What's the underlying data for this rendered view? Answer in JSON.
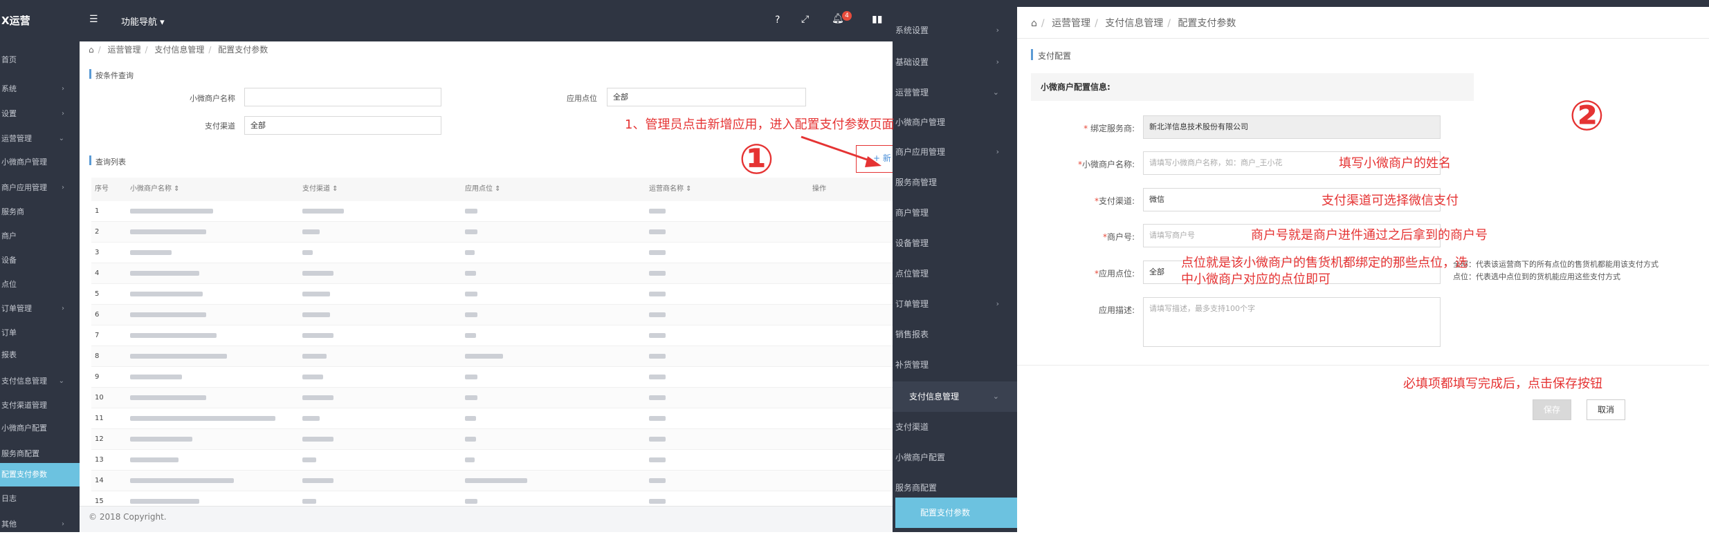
{
  "left": {
    "logo": "X运营",
    "nav_label": "功能导航",
    "sidebar": [
      {
        "label": "首页",
        "chev": ""
      },
      {
        "label": "系统",
        "chev": "›"
      },
      {
        "label": "设置",
        "chev": "›"
      },
      {
        "label": "运营管理",
        "chev": "⌄"
      },
      {
        "label": "小微商户管理",
        "chev": ""
      },
      {
        "label": "商户应用管理",
        "chev": "›"
      },
      {
        "label": "服务商",
        "chev": ""
      },
      {
        "label": "商户",
        "chev": ""
      },
      {
        "label": "设备",
        "chev": ""
      },
      {
        "label": "点位",
        "chev": ""
      },
      {
        "label": "订单管理",
        "chev": "›"
      },
      {
        "label": "订单",
        "chev": ""
      },
      {
        "label": "报表",
        "chev": ""
      },
      {
        "label": "支付信息管理",
        "chev": "⌄"
      },
      {
        "label": "支付渠道管理",
        "chev": ""
      },
      {
        "label": "小微商户配置",
        "chev": ""
      },
      {
        "label": "服务商配置",
        "chev": ""
      },
      {
        "label": "配置支付参数",
        "chev": ""
      },
      {
        "label": "日志",
        "chev": ""
      },
      {
        "label": "其他",
        "chev": "›"
      }
    ],
    "breadcrumb": [
      "运营管理",
      "支付信息管理",
      "配置支付参数"
    ],
    "search_section": "按条件查询",
    "filter": {
      "merchant_label": "小微商户名称",
      "merchant_value": "",
      "point_label": "应用点位",
      "point_value": "全部",
      "channel_label": "支付渠道",
      "channel_value": "全部"
    },
    "list_section": "查询列表",
    "add_label": "+ 新",
    "columns": [
      "序号",
      "小微商户名称 ⇕",
      "支付渠道 ⇕",
      "应用点位 ⇕",
      "运营商名称 ⇕",
      "操作"
    ],
    "rows": [
      "1",
      "2",
      "3",
      "4",
      "5",
      "6",
      "7",
      "8",
      "9",
      "10",
      "11",
      "12",
      "13",
      "14",
      "15"
    ],
    "footer": "© 2018 Copyright."
  },
  "right": {
    "breadcrumb": [
      "运营管理",
      "支付信息管理",
      "配置支付参数"
    ],
    "section_title": "支付配置",
    "sub_header": "小微商户配置信息:",
    "fields": {
      "provider_label": "绑定服务商:",
      "provider_value": "新北洋信息技术股份有限公司",
      "merchant_label": "小微商户名称:",
      "merchant_placeholder": "请填写小微商户名称，如：商户_王小花",
      "channel_label": "支付渠道:",
      "channel_value": "微信",
      "merchant_no_label": "商户号:",
      "merchant_no_placeholder": "请填写商户号",
      "point_label": "应用点位:",
      "point_value": "全部",
      "desc_label": "应用描述:",
      "desc_placeholder": "请填写描述，最多支持100个字"
    },
    "hints": {
      "all": "全部：代表该运营商下的所有点位的售货机都能用该支付方式",
      "point": "点位：代表选中点位到的货机能应用这些支付方式"
    },
    "save_label": "保存",
    "cancel_label": "取消",
    "sidebar": [
      {
        "label": "系统设置",
        "chev": "›"
      },
      {
        "label": "基础设置",
        "chev": "›"
      },
      {
        "label": "运营管理",
        "chev": "⌄"
      },
      {
        "label": "小微商户管理",
        "chev": ""
      },
      {
        "label": "商户应用管理",
        "chev": "›"
      },
      {
        "label": "服务商管理",
        "chev": ""
      },
      {
        "label": "商户管理",
        "chev": ""
      },
      {
        "label": "设备管理",
        "chev": ""
      },
      {
        "label": "点位管理",
        "chev": ""
      },
      {
        "label": "订单管理",
        "chev": "›"
      },
      {
        "label": "销售报表",
        "chev": ""
      },
      {
        "label": "补货管理",
        "chev": ""
      },
      {
        "label": "支付信息管理",
        "chev": "⌄"
      },
      {
        "label": "支付渠道",
        "chev": ""
      },
      {
        "label": "小微商户配置",
        "chev": ""
      },
      {
        "label": "服务商配置",
        "chev": ""
      },
      {
        "label": "配置支付参数",
        "chev": ""
      }
    ]
  },
  "annotations": {
    "step1": "1、管理员点击新增应用，进入配置支付参数页面",
    "num1": "①",
    "num2": "②",
    "name": "填写小微商户的姓名",
    "channel": "支付渠道可选择微信支付",
    "merchant_no": "商户号就是商户进件通过之后拿到的商户号",
    "point_line1": "点位就是该小微商户的售货机都绑定的那些点位，选",
    "point_line2": "中小微商户对应的点位即可",
    "save": "必填项都填写完成后，点击保存按钮"
  },
  "colors": {
    "accent": "#6cc2e0",
    "sidebar": "#2f3542",
    "annotation": "#e53333"
  }
}
